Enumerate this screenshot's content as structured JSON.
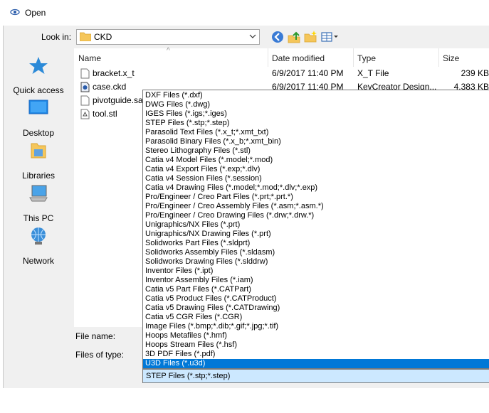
{
  "window": {
    "title": "Open"
  },
  "toolbar": {
    "look_in_label": "Look in:",
    "look_in_value": "CKD"
  },
  "nav": {
    "items": [
      {
        "label": "Quick access",
        "icon": "star-icon"
      },
      {
        "label": "Desktop",
        "icon": "desktop-icon"
      },
      {
        "label": "Libraries",
        "icon": "libraries-icon"
      },
      {
        "label": "This PC",
        "icon": "computer-icon"
      },
      {
        "label": "Network",
        "icon": "network-icon"
      }
    ]
  },
  "file_list": {
    "columns": [
      "Name",
      "Date modified",
      "Type",
      "Size"
    ],
    "rows": [
      {
        "name": "bracket.x_t",
        "date": "6/9/2017 11:40 PM",
        "type": "X_T File",
        "size": "239 KB",
        "icon": "document-icon"
      },
      {
        "name": "case.ckd",
        "date": "6/9/2017 11:40 PM",
        "type": "KeyCreator Design...",
        "size": "4,383 KB",
        "icon": "ckd-file-icon"
      },
      {
        "name": "pivotguide.sat",
        "date": "",
        "type": "",
        "size": "",
        "icon": "document-icon"
      },
      {
        "name": "tool.stl",
        "date": "",
        "type": "",
        "size": "",
        "icon": "stl-file-icon"
      }
    ]
  },
  "form": {
    "file_name_label": "File name:",
    "files_of_type_label": "Files of type:",
    "files_of_type_value": "STEP Files (*.stp;*.step)"
  },
  "file_types": {
    "selected_index": 30,
    "options": [
      "DXF Files (*.dxf)",
      "DWG Files (*.dwg)",
      "IGES Files (*.igs;*.iges)",
      "STEP Files (*.stp;*.step)",
      "Parasolid Text Files (*.x_t;*.xmt_txt)",
      "Parasolid Binary Files (*.x_b;*.xmt_bin)",
      "Stereo Lithography Files (*.stl)",
      "Catia v4 Model Files (*.model;*.mod)",
      "Catia v4 Export Files (*.exp;*.dlv)",
      "Catia v4 Session Files (*.session)",
      "Catia v4 Drawing Files (*.model;*.mod;*.dlv;*.exp)",
      "Pro/Engineer / Creo Part Files (*.prt;*.prt.*)",
      "Pro/Engineer / Creo Assembly Files (*.asm;*.asm.*)",
      "Pro/Engineer / Creo Drawing Files (*.drw;*.drw.*)",
      "Unigraphics/NX Files (*.prt)",
      "Unigraphics/NX Drawing Files (*.prt)",
      "Solidworks Part Files (*.sldprt)",
      "Solidworks Assembly Files (*.sldasm)",
      "Solidworks Drawing Files (*.slddrw)",
      "Inventor Files (*.ipt)",
      "Inventor Assembly Files (*.iam)",
      "Catia v5 Part Files (*.CATPart)",
      "Catia v5 Product Files (*.CATProduct)",
      "Catia v5 Drawing Files (*.CATDrawing)",
      "Catia v5 CGR Files (*.CGR)",
      "Image Files (*.bmp;*.dib;*.gif;*.jpg;*.tif)",
      "Hoops Metafiles (*.hmf)",
      "Hoops Stream Files (*.hsf)",
      "3D PDF Files (*.pdf)",
      "U3D Files (*.u3d)"
    ]
  },
  "colors": {
    "selection": "#0078d7",
    "combo_highlight": "#cce8ff",
    "dialog_bg": "#f0f0f0"
  }
}
